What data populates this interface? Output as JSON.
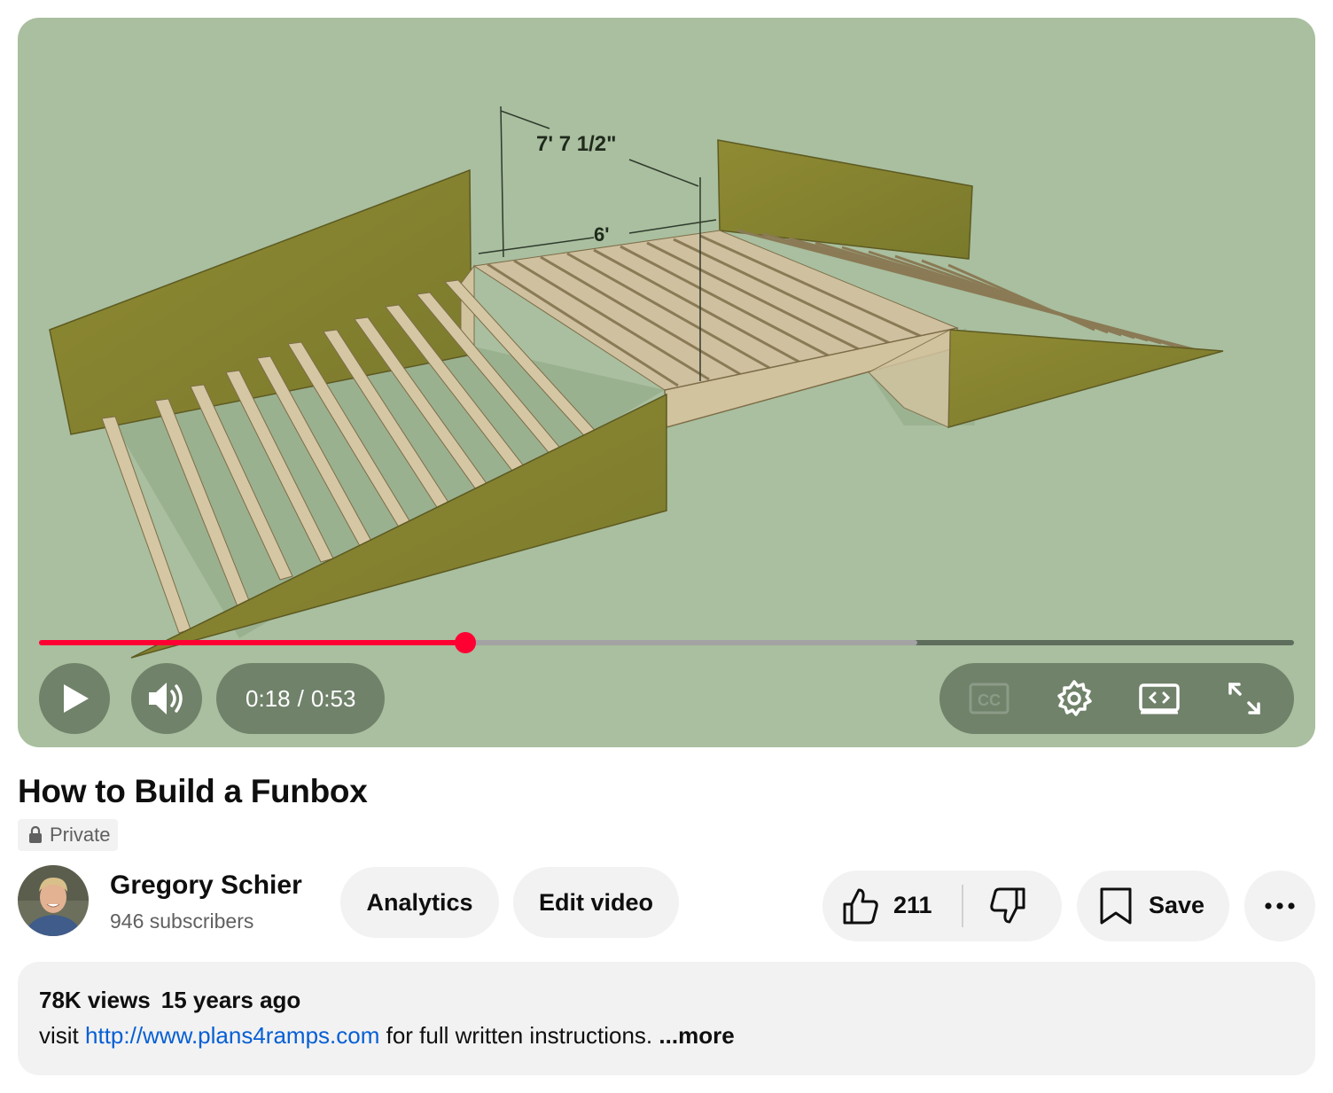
{
  "player": {
    "current_time": "0:18",
    "time_separator": "/",
    "duration": "0:53",
    "played_fraction": 0.34,
    "buffered_fraction": 0.7,
    "diagram_labels": {
      "span_top": "7' 7 1/2\"",
      "span_bottom": "6'"
    },
    "controls": {
      "play": "play-icon",
      "volume": "volume-icon",
      "captions": "cc-icon",
      "settings": "gear-icon",
      "theater": "theater-mode-icon",
      "fullscreen": "fullscreen-icon"
    },
    "colors": {
      "progress": "#ff0033",
      "background": "#a9bf9f"
    }
  },
  "video": {
    "title": "How to Build a Funbox",
    "visibility": "Private"
  },
  "channel": {
    "name": "Gregory Schier",
    "subscribers": "946 subscribers"
  },
  "actions": {
    "analytics": "Analytics",
    "edit_video": "Edit video",
    "likes": "211",
    "save": "Save"
  },
  "description": {
    "views": "78K views",
    "age": "15 years ago",
    "prefix": "visit",
    "link": "http://www.plans4ramps.com",
    "suffix": "for full written instructions.",
    "more": "...more"
  }
}
